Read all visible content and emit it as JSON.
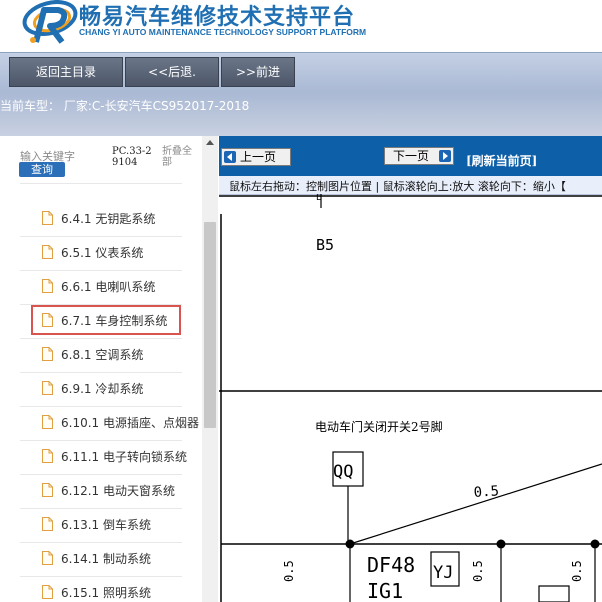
{
  "header": {
    "title": "畅易汽车维修技术支持平台",
    "subtitle": "CHANG YI AUTO MAINTENANCE TECHNOLOGY SUPPORT PLATFORM"
  },
  "toolbar": {
    "home_label": "返回主目录",
    "back_label": "<<后退.",
    "forward_label": ">>前进"
  },
  "vehicle": {
    "current": "当前车型：  厂家:C-长安汽车CS952017-2018"
  },
  "search": {
    "keyword_label": "输入关键字",
    "query_label": "查询",
    "pc_code": "PC.33-29104",
    "fold_label": "折叠全部"
  },
  "tree": {
    "items": [
      {
        "label": "6.4.1 无钥匙系统"
      },
      {
        "label": "6.5.1 仪表系统"
      },
      {
        "label": "6.6.1 电喇叭系统"
      },
      {
        "label": "6.7.1 车身控制系统"
      },
      {
        "label": "6.8.1 空调系统"
      },
      {
        "label": "6.9.1 冷却系统"
      },
      {
        "label": "6.10.1 电源插座、点烟器"
      },
      {
        "label": "6.11.1 电子转向锁系统"
      },
      {
        "label": "6.12.1 电动天窗系统"
      },
      {
        "label": "6.13.1 倒车系统"
      },
      {
        "label": "6.14.1 制动系统"
      },
      {
        "label": "6.15.1 照明系统"
      }
    ],
    "selected_index": 3
  },
  "viewer": {
    "prev_label": "上一页",
    "next_label": "下一页",
    "refresh_label": "[刷新当前页]",
    "hint": "鼠标左右拖动：控制图片位置 | 鼠标滚轮向上:放大  滚轮向下：缩小【"
  },
  "diagram": {
    "b5": "B5",
    "switch_title": "电动车门关闭开关2号脚",
    "qq": "QQ",
    "wire_05": "0.5",
    "df48": "DF48",
    "ig1": "IG1",
    "yj": "YJ"
  },
  "colors": {
    "brand": "#1f6fb2",
    "nav_bar": "#0d5fa8",
    "toolbar": "#b4c2da",
    "highlight": "#d9534f"
  }
}
